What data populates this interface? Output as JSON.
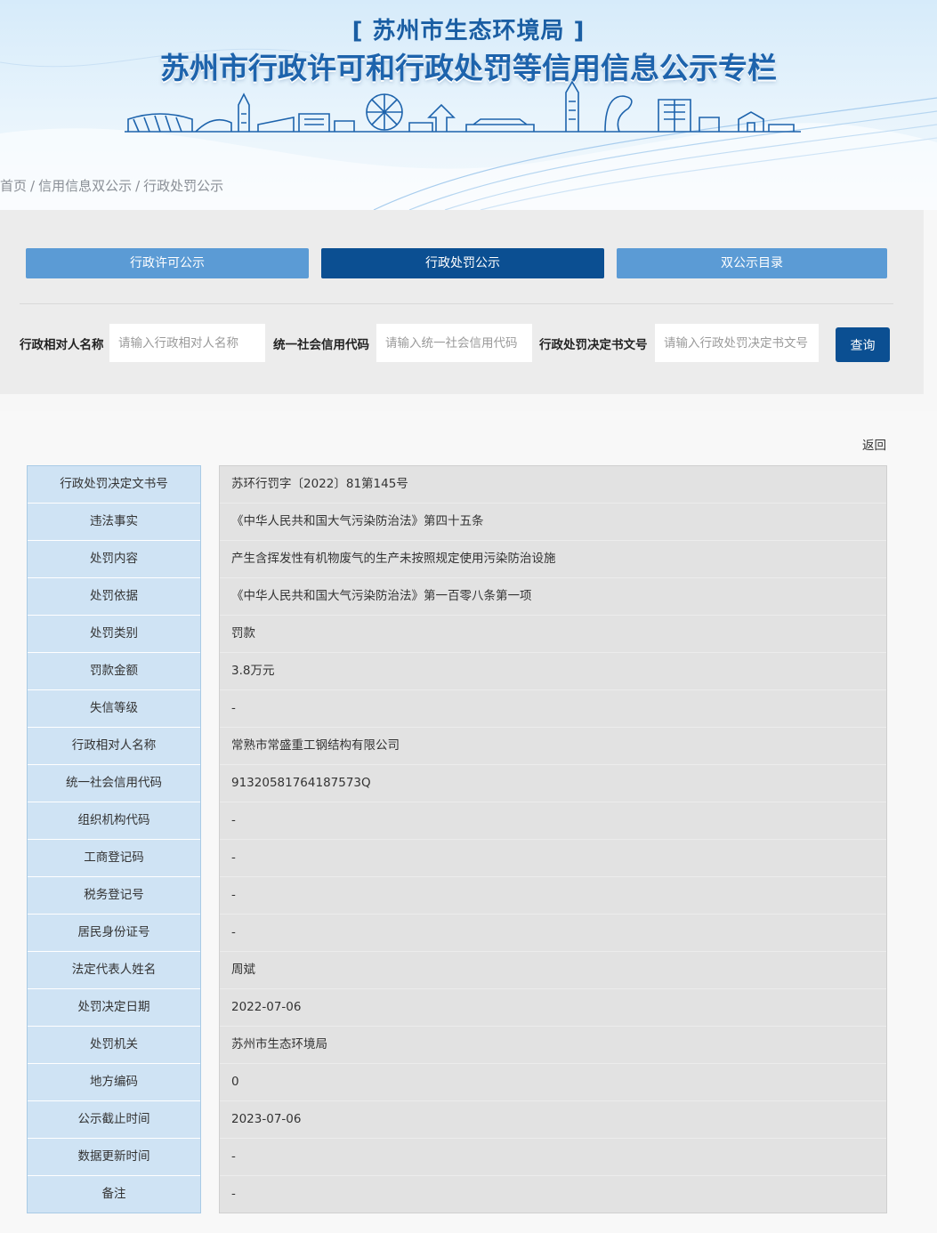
{
  "header": {
    "subtitle": "[ 苏州市生态环境局 ]",
    "title": "苏州市行政许可和行政处罚等信用信息公示专栏"
  },
  "breadcrumb": [
    "首页",
    "信用信息双公示",
    "行政处罚公示"
  ],
  "breadcrumb_sep": "/",
  "tabs": {
    "license": "行政许可公示",
    "penalty": "行政处罚公示",
    "catalog": "双公示目录"
  },
  "search": {
    "name_label": "行政相对人名称",
    "name_placeholder": "请输入行政相对人名称",
    "code_label": "统一社会信用代码",
    "code_placeholder": "请输入统一社会信用代码",
    "doc_label": "行政处罚决定书文号",
    "doc_placeholder": "请输入行政处罚决定书文号",
    "button": "查询"
  },
  "back_label": "返回",
  "details": [
    {
      "label": "行政处罚决定文书号",
      "value": "苏环行罚字〔2022〕81第145号"
    },
    {
      "label": "违法事实",
      "value": "《中华人民共和国大气污染防治法》第四十五条"
    },
    {
      "label": "处罚内容",
      "value": "产生含挥发性有机物废气的生产未按照规定使用污染防治设施"
    },
    {
      "label": "处罚依据",
      "value": "《中华人民共和国大气污染防治法》第一百零八条第一项"
    },
    {
      "label": "处罚类别",
      "value": "罚款"
    },
    {
      "label": "罚款金额",
      "value": "3.8万元"
    },
    {
      "label": "失信等级",
      "value": "-"
    },
    {
      "label": "行政相对人名称",
      "value": "常熟市常盛重工钢结构有限公司"
    },
    {
      "label": "统一社会信用代码",
      "value": "91320581764187573Q"
    },
    {
      "label": "组织机构代码",
      "value": "-"
    },
    {
      "label": "工商登记码",
      "value": "-"
    },
    {
      "label": "税务登记号",
      "value": "-"
    },
    {
      "label": "居民身份证号",
      "value": "-"
    },
    {
      "label": "法定代表人姓名",
      "value": "周斌"
    },
    {
      "label": "处罚决定日期",
      "value": "2022-07-06"
    },
    {
      "label": "处罚机关",
      "value": "苏州市生态环境局"
    },
    {
      "label": "地方编码",
      "value": "0"
    },
    {
      "label": "公示截止时间",
      "value": "2023-07-06"
    },
    {
      "label": "数据更新时间",
      "value": "-"
    },
    {
      "label": "备注",
      "value": "-"
    }
  ]
}
